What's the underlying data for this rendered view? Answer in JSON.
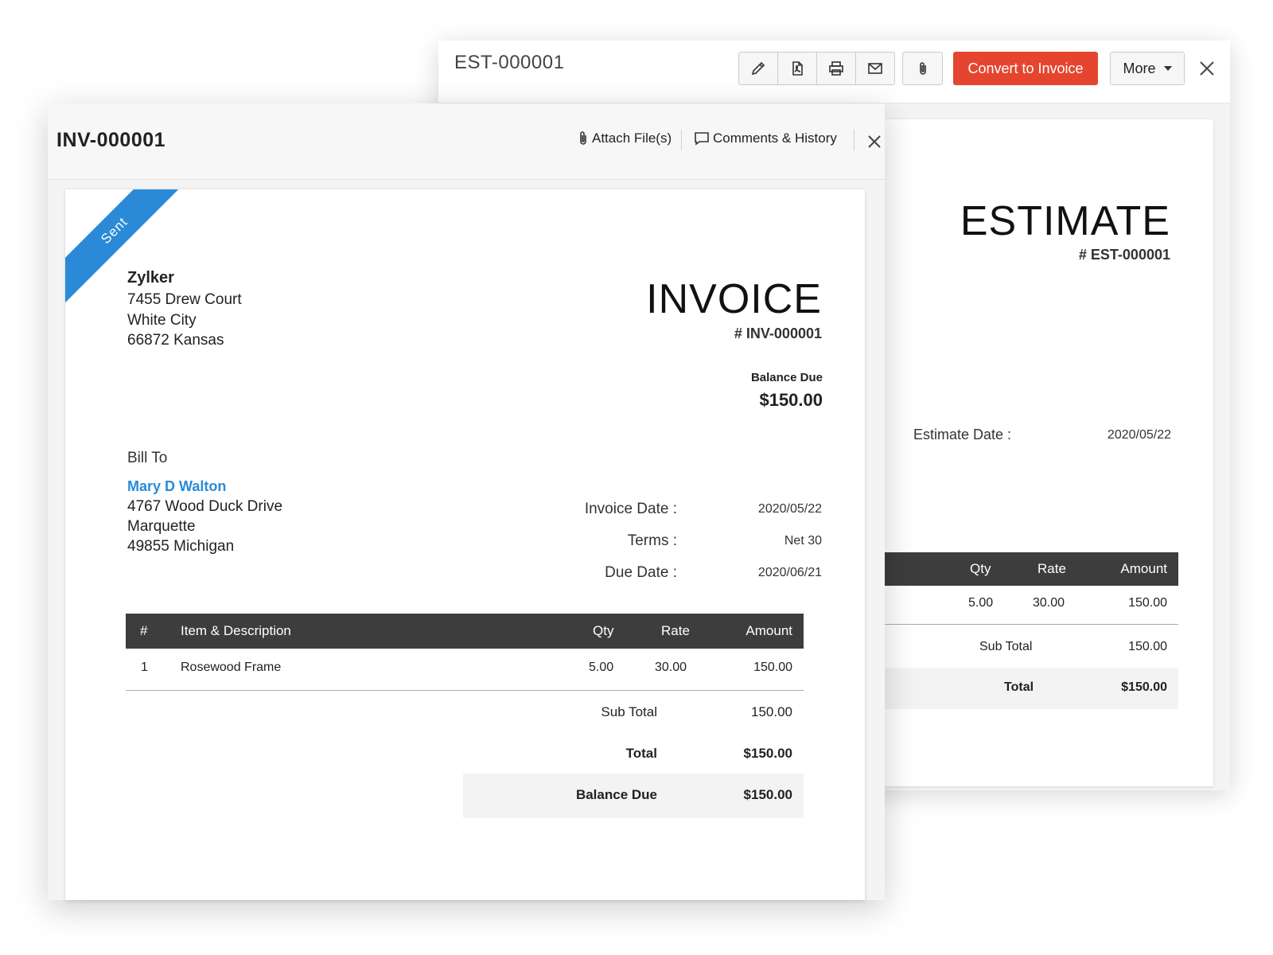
{
  "estimate": {
    "window_id": "EST-000001",
    "toolbar": {
      "edit_icon": "pencil-icon",
      "pdf_icon": "pdf-icon",
      "print_icon": "printer-icon",
      "email_icon": "envelope-icon",
      "attach_icon": "paperclip-icon"
    },
    "convert_label": "Convert to Invoice",
    "more_label": "More",
    "title": "ESTIMATE",
    "number": "# EST-000001",
    "date_label": "Estimate Date :",
    "date_value": "2020/05/22",
    "columns": {
      "qty": "Qty",
      "rate": "Rate",
      "amount": "Amount"
    },
    "item": {
      "qty": "5.00",
      "rate": "30.00",
      "amount": "150.00"
    },
    "sub_total_label": "Sub Total",
    "sub_total_value": "150.00",
    "total_label": "Total",
    "total_value": "$150.00",
    "accent_color": "#e5452e"
  },
  "invoice": {
    "window_id": "INV-000001",
    "attach_label": "Attach File(s)",
    "comments_label": "Comments & History",
    "status_ribbon": "Sent",
    "ribbon_color": "#2a8ad8",
    "organization": {
      "name": "Zylker",
      "address_line1": "7455 Drew Court",
      "address_line2": "White City",
      "address_line3": "66872 Kansas"
    },
    "title": "INVOICE",
    "number": "# INV-000001",
    "balance_due_label": "Balance Due",
    "balance_due_value": "$150.00",
    "bill_to_label": "Bill To",
    "customer": {
      "name": "Mary D Walton",
      "address_line1": "4767 Wood Duck Drive",
      "address_line2": "Marquette",
      "address_line3": "49855 Michigan"
    },
    "meta": {
      "invoice_date_label": "Invoice Date :",
      "invoice_date_value": "2020/05/22",
      "terms_label": "Terms :",
      "terms_value": "Net 30",
      "due_date_label": "Due Date :",
      "due_date_value": "2020/06/21"
    },
    "columns": {
      "num": "#",
      "item": "Item & Description",
      "qty": "Qty",
      "rate": "Rate",
      "amount": "Amount"
    },
    "items": [
      {
        "num": "1",
        "name": "Rosewood Frame",
        "qty": "5.00",
        "rate": "30.00",
        "amount": "150.00"
      }
    ],
    "sub_total_label": "Sub Total",
    "sub_total_value": "150.00",
    "total_label": "Total",
    "total_value": "$150.00",
    "balance_label": "Balance Due",
    "balance_value": "$150.00"
  }
}
